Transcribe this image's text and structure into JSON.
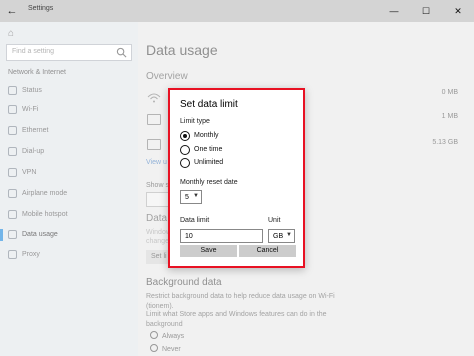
{
  "window": {
    "title": "Settings",
    "back_glyph": "←",
    "minimize_glyph": "—",
    "maximize_glyph": "☐",
    "close_glyph": "✕"
  },
  "sidebar": {
    "home_glyph": "⌂",
    "search_placeholder": "Find a setting",
    "section": "Network & Internet",
    "items": [
      {
        "label": "Status",
        "icon": "status-icon"
      },
      {
        "label": "Wi-Fi",
        "icon": "wifi-icon"
      },
      {
        "label": "Ethernet",
        "icon": "ethernet-icon"
      },
      {
        "label": "Dial-up",
        "icon": "dialup-icon"
      },
      {
        "label": "VPN",
        "icon": "vpn-icon"
      },
      {
        "label": "Airplane mode",
        "icon": "airplane-icon"
      },
      {
        "label": "Mobile hotspot",
        "icon": "hotspot-icon"
      },
      {
        "label": "Data usage",
        "icon": "data-usage-icon",
        "active": true
      },
      {
        "label": "Proxy",
        "icon": "proxy-icon"
      }
    ]
  },
  "main": {
    "title": "Data usage",
    "overview": "Overview",
    "usage": [
      "0 MB",
      "1 MB",
      "5.13 GB"
    ],
    "view_usage": "View u",
    "show_settings": "Show se",
    "data_limit_head": "Data li",
    "ghost_lines": [
      "Windows",
      "change"
    ],
    "ghost_button": "Set li",
    "background_head": "Background data",
    "background_desc": "Restrict background data to help reduce data usage on Wi-Fi (tionem).",
    "background_desc2": "Limit what Store apps and Windows features can do in the background",
    "background_options": [
      "Always",
      "Never"
    ]
  },
  "dialog": {
    "title": "Set data limit",
    "limit_type_label": "Limit type",
    "limit_types": [
      "Monthly",
      "One time",
      "Unlimited"
    ],
    "selected_limit_type": "Monthly",
    "reset_date_label": "Monthly reset date",
    "reset_date_value": "5",
    "data_limit_label": "Data limit",
    "data_limit_value": "10",
    "unit_label": "Unit",
    "unit_value": "GB",
    "save_label": "Save",
    "cancel_label": "Cancel"
  },
  "colors": {
    "accent": "#0078d7",
    "highlight_border": "#e81123"
  }
}
